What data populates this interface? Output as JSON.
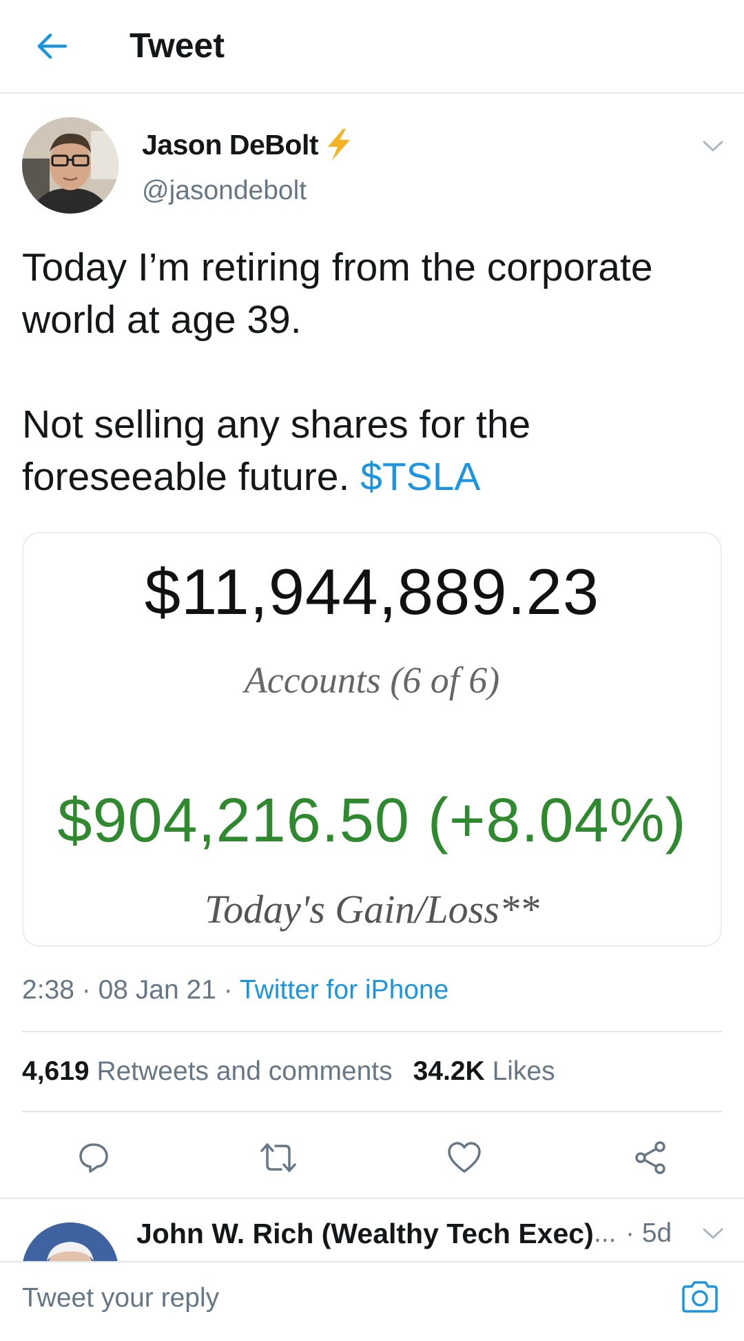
{
  "header": {
    "title": "Tweet",
    "back_icon": "arrow-left-icon",
    "accent_color": "#1b95e0"
  },
  "tweet": {
    "author": {
      "name": "Jason DeBolt",
      "handle": "@jasondebolt",
      "badge_icon": "lightning-bolt-icon"
    },
    "text": {
      "line1": "Today I’m retiring from the corporate world at age 39.",
      "line2_prefix": "Not selling any shares for the foreseeable future. ",
      "cashtag": "$TSLA"
    },
    "media": {
      "total_value": "$11,944,889.23",
      "accounts_label": "Accounts (6 of 6)",
      "gain_value": "$904,216.50 (+8.04%)",
      "gain_label": "Today's Gain/Loss**",
      "gain_color": "#2f8a2f"
    },
    "meta": {
      "time": "2:38",
      "separator1": " · ",
      "date": "08 Jan 21",
      "separator2": " · ",
      "source": "Twitter for iPhone"
    },
    "stats": {
      "retweets_count": "4,619",
      "retweets_label": "Retweets and comments",
      "likes_count": "34.2K",
      "likes_label": "Likes"
    },
    "actions": [
      {
        "name": "reply-icon"
      },
      {
        "name": "retweet-icon"
      },
      {
        "name": "heart-icon"
      },
      {
        "name": "share-icon"
      }
    ]
  },
  "reply_preview": {
    "name": "John W. Rich (Wealthy Tech Exec)",
    "ellipsis": "...",
    "time": "· 5d"
  },
  "compose": {
    "placeholder": "Tweet your reply",
    "camera_icon": "camera-icon"
  }
}
